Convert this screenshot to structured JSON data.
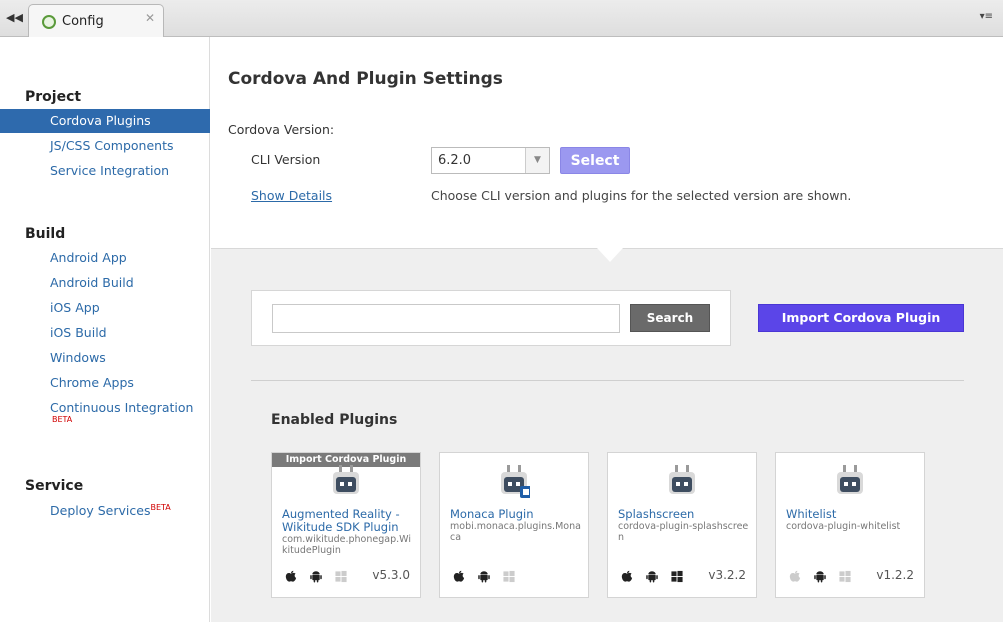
{
  "tabbar": {
    "nav_glyph": "◀◀",
    "tab_label": "Config",
    "tab_close": "✕",
    "menu_glyph": "▾≡"
  },
  "sidebar": {
    "sections": [
      {
        "title": "Project",
        "items": [
          {
            "label": "Cordova Plugins",
            "active": true
          },
          {
            "label": "JS/CSS Components"
          },
          {
            "label": "Service Integration"
          }
        ]
      },
      {
        "title": "Build",
        "items": [
          {
            "label": "Android App"
          },
          {
            "label": "Android Build"
          },
          {
            "label": "iOS App"
          },
          {
            "label": "iOS Build"
          },
          {
            "label": "Windows"
          },
          {
            "label": "Chrome Apps"
          },
          {
            "label": "Continuous Integration",
            "badge": "BETA"
          }
        ]
      },
      {
        "title": "Service",
        "items": [
          {
            "label": "Deploy Services",
            "badge": "BETA"
          }
        ]
      }
    ]
  },
  "settings": {
    "title": "Cordova And Plugin Settings",
    "cordova_version_label": "Cordova Version:",
    "cli_version_label": "CLI Version",
    "cli_version_value": "6.2.0",
    "select_button": "Select",
    "show_details": "Show Details",
    "help_text": "Choose CLI version and plugins for the selected version are shown."
  },
  "search": {
    "placeholder": "",
    "value": "",
    "button": "Search"
  },
  "import_button": "Import Cordova Plugin",
  "enabled_title": "Enabled Plugins",
  "plugins": [
    {
      "banner": "Import Cordova Plugin",
      "name": "Augmented Reality - Wikitude SDK Plugin",
      "id": "com.wikitude.phonegap.WikitudePlugin",
      "version": "v5.3.0",
      "platforms": {
        "ios": true,
        "android": true,
        "windows": false
      }
    },
    {
      "name": "Monaca Plugin",
      "id": "mobi.monaca.plugins.Monaca",
      "version": "",
      "platforms": {
        "ios": true,
        "android": true,
        "windows": false
      }
    },
    {
      "name": "Splashscreen",
      "id": "cordova-plugin-splashscreen",
      "version": "v3.2.2",
      "platforms": {
        "ios": true,
        "android": true,
        "windows": true
      }
    },
    {
      "name": "Whitelist",
      "id": "cordova-plugin-whitelist",
      "version": "v1.2.2",
      "platforms": {
        "ios": false,
        "android": true,
        "windows": false
      }
    }
  ],
  "colors": {
    "accent": "#5b45e8",
    "select_button": "#9b98f0",
    "active_nav": "#2e6aad",
    "link": "#2c6aa8",
    "beta": "#d00000"
  }
}
